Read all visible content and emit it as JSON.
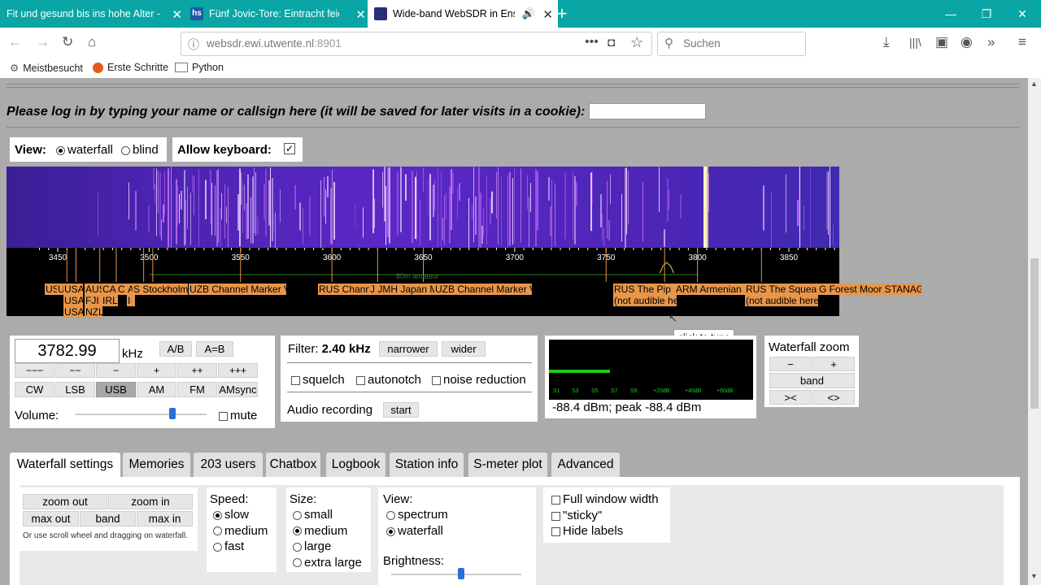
{
  "browser": {
    "tabs": [
      {
        "title": "Fit und gesund bis ins hohe Alter - F"
      },
      {
        "title": "Fünf Jovic-Tore: Eintracht feiert"
      },
      {
        "title": "Wide-band WebSDR in Ens"
      }
    ],
    "new_tab": "+",
    "url_domain": "websdr.ewi.utwente.nl",
    "url_port": ":8901",
    "search_placeholder": "Suchen",
    "bookmarks": [
      "Meistbesucht",
      "Erste Schritte",
      "Python"
    ]
  },
  "login": {
    "prompt": "Please log in by typing your name or callsign here (it will be saved for later visits in a cookie):",
    "value": ""
  },
  "view_bar": {
    "view_label": "View:",
    "waterfall": "waterfall",
    "blind": "blind",
    "selected": "waterfall",
    "keyboard_label": "Allow keyboard:",
    "keyboard_checked": true
  },
  "scale": {
    "ticks": [
      "3450",
      "3500",
      "3550",
      "3600",
      "3650",
      "3700",
      "3750",
      "3800",
      "3850"
    ],
    "band_label": "80m amateur"
  },
  "stations": [
    {
      "text": "US"
    },
    {
      "text": "U"
    },
    {
      "text": "USA\nUSA\nUSA"
    },
    {
      "text": "AUS\nFJI\nNZL"
    },
    {
      "text": "CA\nIRL"
    },
    {
      "text": "C"
    },
    {
      "text": "A\nI"
    },
    {
      "text": "S Stockholm"
    },
    {
      "text": "UZB Channel Marker V"
    },
    {
      "text": "RUS Chann"
    },
    {
      "text": "J JMH Japan M"
    },
    {
      "text": "UZB Channel Marker V"
    },
    {
      "text": "RUS The Pip\n(not audible he"
    },
    {
      "text": "ARM Armenian"
    },
    {
      "text": "RUS The Squea\n(not audible here"
    },
    {
      "text": "G Forest Moor STANAG"
    }
  ],
  "tooltip": "click to tune",
  "tuning": {
    "frequency": "3782.99",
    "unit": "kHz",
    "ab": "A/B",
    "aeqb": "A=B",
    "steps": [
      "−−−",
      "−−",
      "−",
      "+",
      "++",
      "+++"
    ],
    "modes": [
      "CW",
      "LSB",
      "USB",
      "AM",
      "FM",
      "AMsync"
    ],
    "active_mode": "USB",
    "volume_label": "Volume:",
    "volume_level": 0.74,
    "mute": "mute"
  },
  "filter": {
    "label": "Filter:",
    "value": "2.40 kHz",
    "narrower": "narrower",
    "wider": "wider",
    "squelch": "squelch",
    "autonotch": "autonotch",
    "noise_reduction": "noise reduction",
    "audio_recording": "Audio recording",
    "start": "start"
  },
  "smeter": {
    "scale_labels": [
      "S1",
      "S3",
      "S5",
      "S7",
      "S9",
      "+20dB",
      "+40dB",
      "+60dB"
    ],
    "reading": "-88.4 dBm; peak  -88.4 dBm",
    "level": 0.3
  },
  "wf_zoom": {
    "title": "Waterfall zoom",
    "minus": "−",
    "plus": "+",
    "band": "band",
    "narrow": "><",
    "wide": "<>"
  },
  "panel_tabs": [
    "Waterfall settings",
    "Memories",
    "203 users",
    "Chatbox",
    "Logbook",
    "Station info",
    "S-meter plot",
    "Advanced"
  ],
  "wf_settings": {
    "zoom_out": "zoom out",
    "zoom_in": "zoom in",
    "max_out": "max out",
    "band": "band",
    "max_in": "max in",
    "hint": "Or use scroll wheel and dragging on waterfall.",
    "speed_label": "Speed:",
    "speeds": [
      "slow",
      "medium",
      "fast"
    ],
    "speed_selected": "slow",
    "size_label": "Size:",
    "sizes": [
      "small",
      "medium",
      "large",
      "extra large"
    ],
    "size_selected": "medium",
    "view_label": "View:",
    "views": [
      "spectrum",
      "waterfall"
    ],
    "view_selected": "waterfall",
    "brightness_label": "Brightness:",
    "brightness_level": 0.54,
    "full_width": "Full window width",
    "sticky": "\"sticky\"",
    "hide_labels": "Hide labels"
  }
}
